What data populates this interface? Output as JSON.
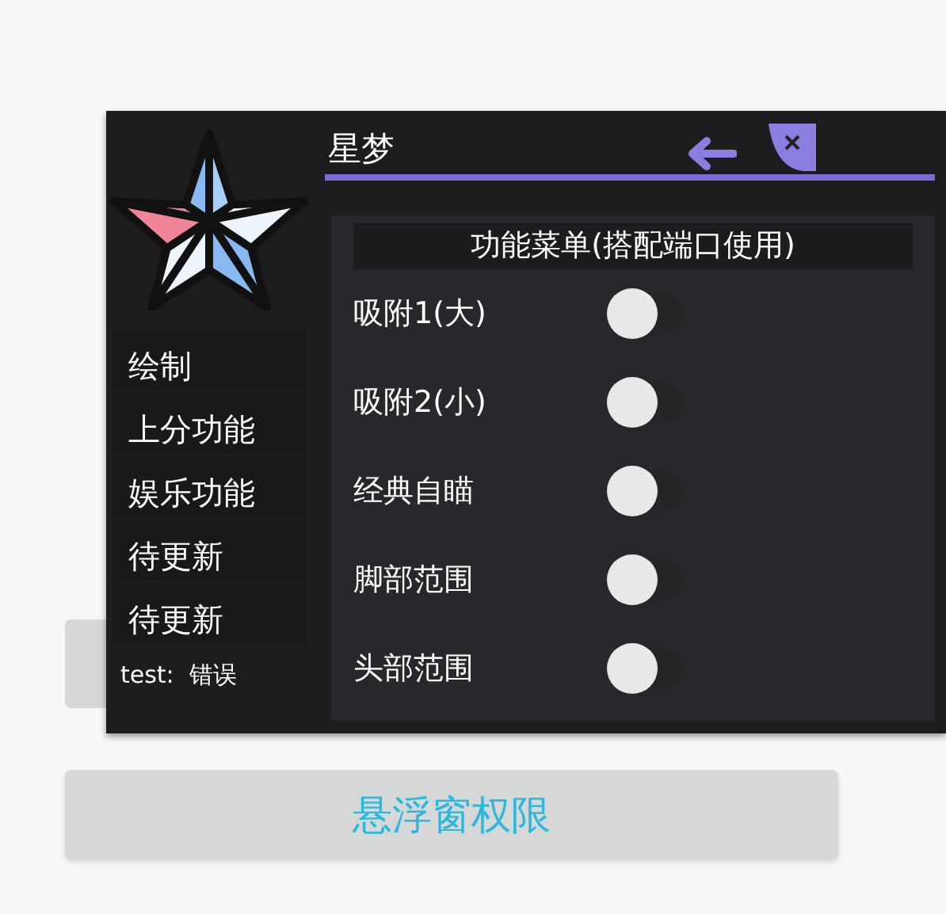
{
  "page_buttons": [
    {
      "label": "悬浮窗权限"
    }
  ],
  "floating_window": {
    "title": "星梦",
    "nav_items": [
      {
        "label": "绘制"
      },
      {
        "label": "上分功能"
      },
      {
        "label": "娱乐功能"
      },
      {
        "label": "待更新"
      },
      {
        "label": "待更新"
      }
    ],
    "status_text": "test:  错误",
    "menu_title": "功能菜单(搭配端口使用)",
    "switches": [
      {
        "label": "吸附1(大)",
        "on": false
      },
      {
        "label": "吸附2(小)",
        "on": false
      },
      {
        "label": "经典自瞄",
        "on": false
      },
      {
        "label": "脚部范围",
        "on": false
      },
      {
        "label": "头部范围",
        "on": false
      }
    ]
  }
}
